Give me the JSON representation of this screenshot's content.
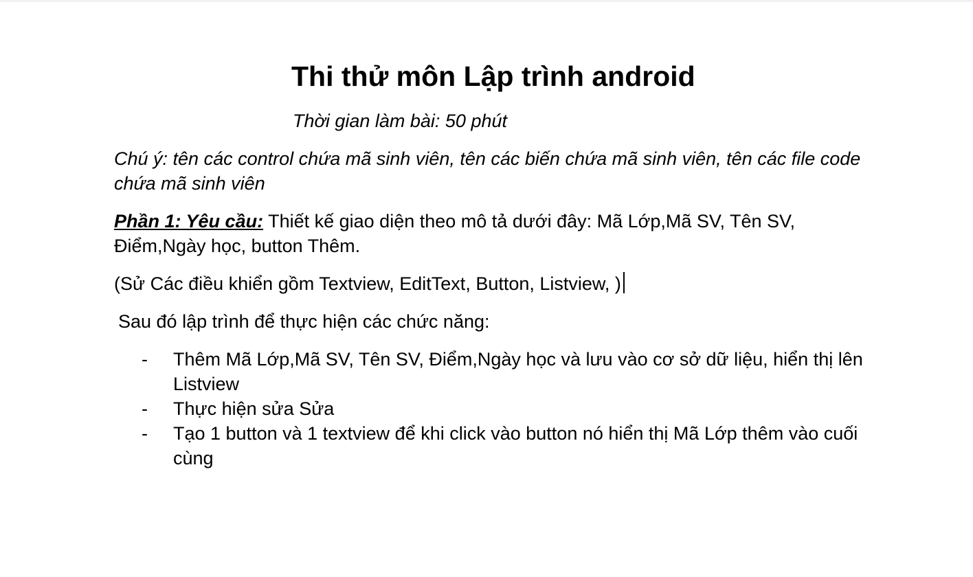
{
  "document": {
    "title": "Thi thử môn Lập trình android",
    "subtitle": "Thời gian làm bài: 50 phút",
    "note": "Chú ý: tên các control chứa mã sinh viên, tên các biến chứa mã sinh viên, tên các file code chứa mã sinh viên",
    "requirement": {
      "label": "Phần 1: Yêu cầu:",
      "text": "Thiết kế giao diện theo mô tả dưới đây: Mã Lớp,Mã SV, Tên SV, Điểm,Ngày học, button Thêm."
    },
    "controls_note": "(Sử Các điều khiển gồm Textview, EditText, Button, Listview, )",
    "intro": "Sau đó lập trình để thực hiện các chức năng:",
    "bullet_symbol": "-",
    "tasks": [
      "Thêm Mã Lớp,Mã SV, Tên SV, Điểm,Ngày học và lưu vào cơ sở dữ liệu, hiển thị lên Listview",
      "Thực hiện sửa Sửa",
      "Tạo 1 button và 1 textview để khi click vào button nó hiển thị Mã Lớp thêm vào cuối cùng"
    ]
  }
}
